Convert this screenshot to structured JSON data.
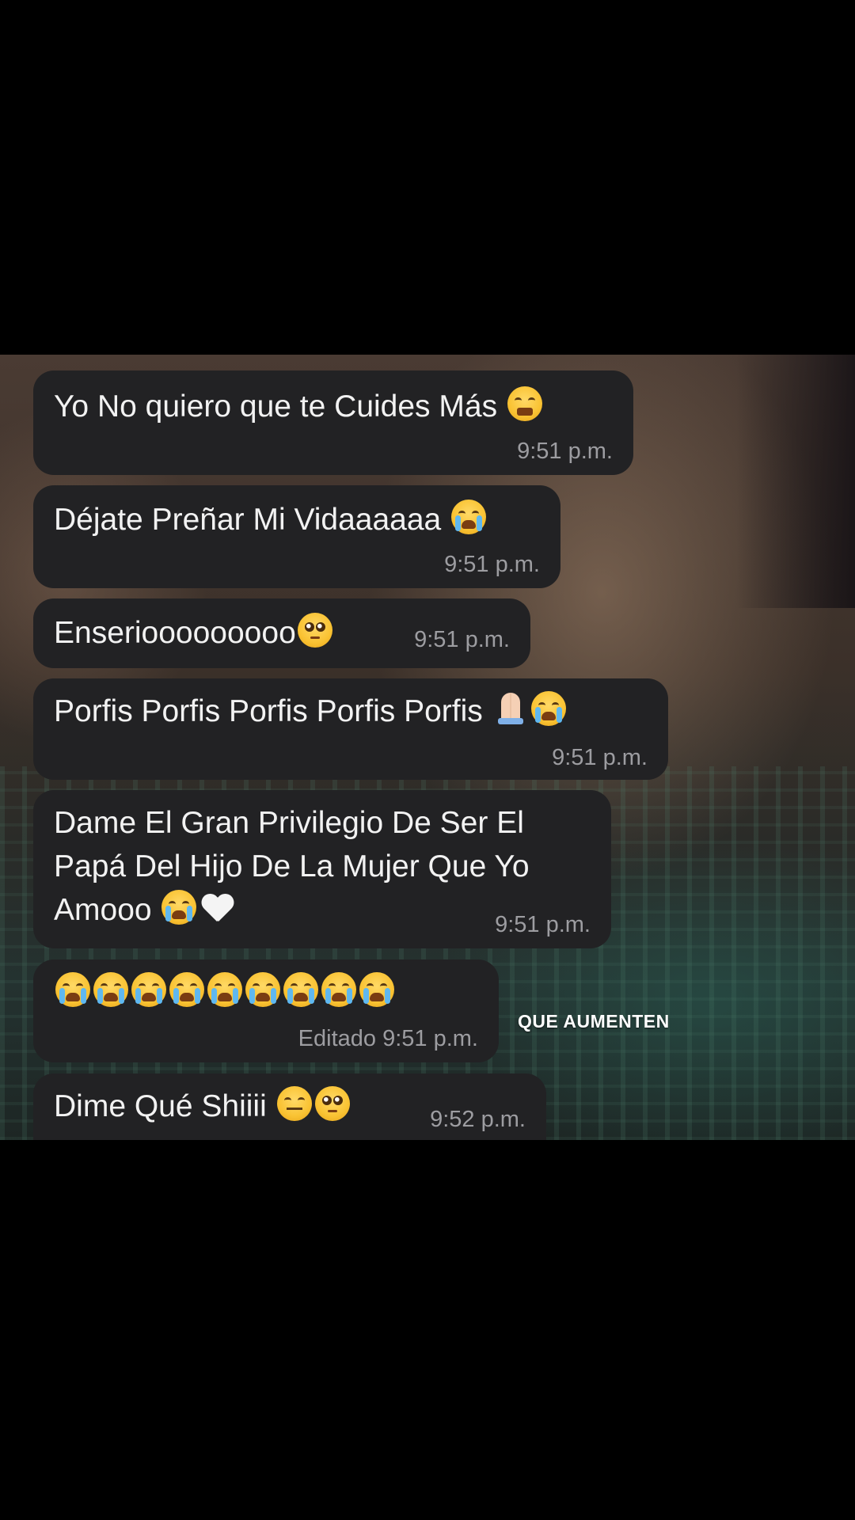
{
  "messages": [
    {
      "text": "Yo No quiero que te Cuides Más",
      "time": "9:51 p.m."
    },
    {
      "text": "Déjate Preñar Mi Vidaaaaaa",
      "time": "9:51 p.m."
    },
    {
      "text": "Enseriooooooooo",
      "time": "9:51 p.m."
    },
    {
      "text": "Porfis Porfis Porfis Porfis Porfis",
      "time": "9:51 p.m."
    },
    {
      "text": "Dame El Gran Privilegio De Ser El",
      "text2": "Papá Del Hijo De La Mujer Que Yo",
      "text3": "Amooo",
      "time": "9:51 p.m."
    },
    {
      "edited": "Editado",
      "time": "9:51 p.m."
    },
    {
      "text": "Dime Qué Shiiii",
      "time": "9:52 p.m."
    }
  ],
  "overlay": {
    "caption": "QUE AUMENTEN"
  },
  "icons": {
    "tired": "tired-face-emoji",
    "crying": "loudly-crying-face-emoji",
    "pleading": "pleading-face-emoji",
    "praying": "folded-hands-emoji",
    "heart": "white-heart-emoji",
    "confounded": "confounded-face-emoji"
  },
  "colors": {
    "bubble": "#222224",
    "timestamp": "#9d9da1",
    "text": "#f2f2f2"
  }
}
